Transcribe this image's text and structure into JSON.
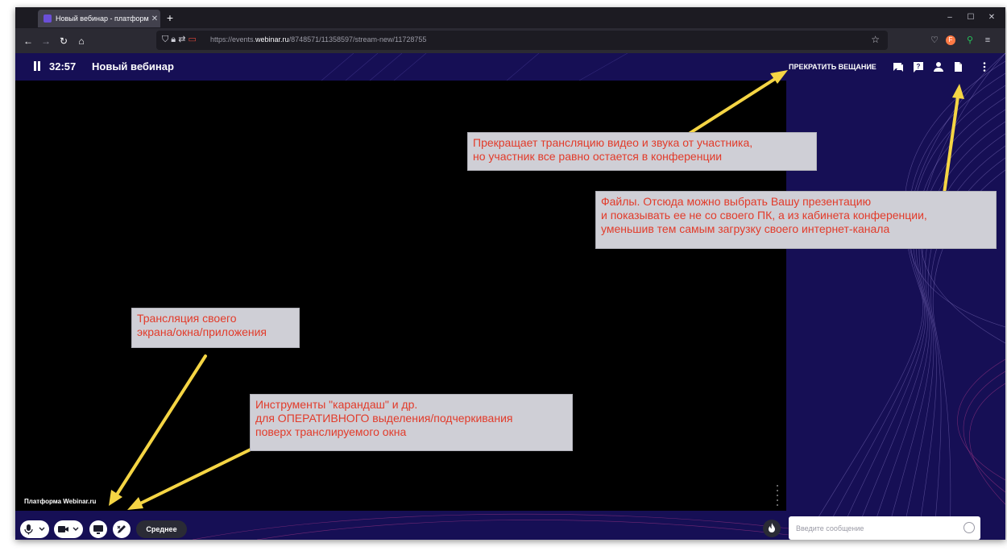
{
  "browser": {
    "tab_title": "Новый вебинар - платформа",
    "tab_close": "✕",
    "new_tab": "+",
    "url_prefix": "https://events.",
    "url_domain": "webinar.ru",
    "url_path": "/8748571/11358597/stream-new/11728755",
    "window_controls": [
      "–",
      "☐",
      "✕"
    ]
  },
  "webinar": {
    "timer": "32:57",
    "title": "Новый вебинар",
    "stop_broadcast": "ПРЕКРАТИТЬ ВЕЩАНИЕ",
    "platform_label": "Платформа Webinar.ru",
    "quality": "Среднее",
    "chat_placeholder": "Введите сообщение"
  },
  "annotations": {
    "stop": [
      "Прекращает трансляцию видео и звука от участника,",
      "но участник все равно остается в конференции"
    ],
    "files": [
      "Файлы. Отсюда можно выбрать Вашу презентацию",
      "и показывать ее не со своего ПК, а из кабинета конференции,",
      "уменьшив тем самым загрузку своего интернет-канала"
    ],
    "screen": [
      "Трансляция своего",
      "экрана/окна/приложения"
    ],
    "tools": [
      "Инструменты \"карандаш\"  и др.",
      "для ОПЕРАТИВНОГО выделения/подчеркивания",
      "поверх транслируемого окна"
    ]
  },
  "colors": {
    "accent_bg": "#160f55",
    "annotation_text": "#e23b2a",
    "arrow": "#f5d544"
  }
}
